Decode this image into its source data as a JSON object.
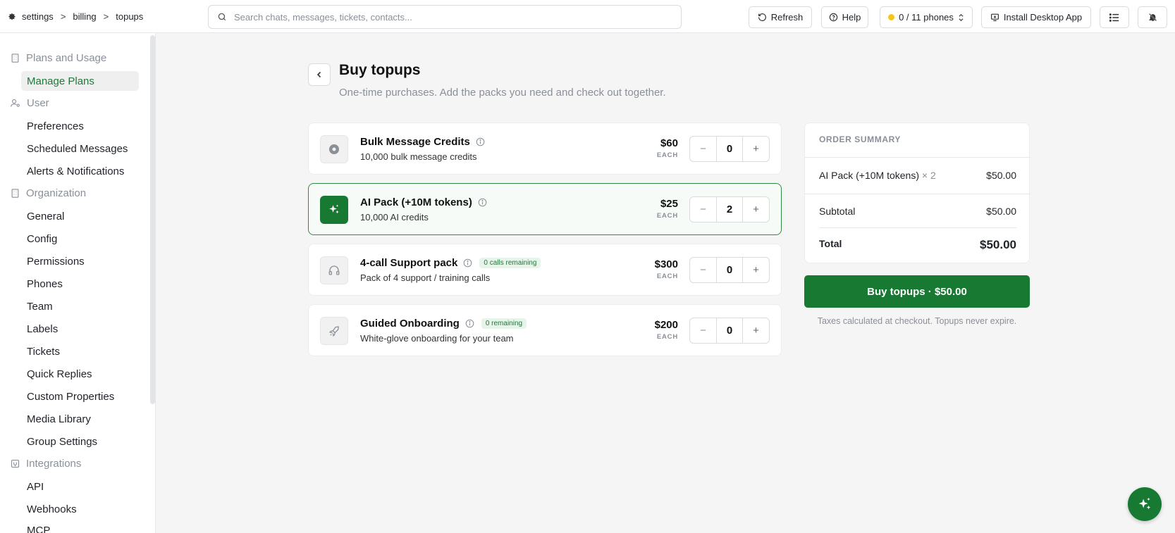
{
  "breadcrumb": {
    "items": [
      "settings",
      "billing",
      "topups"
    ],
    "separator": ">"
  },
  "search": {
    "placeholder": "Search chats, messages, tickets, contacts..."
  },
  "toolbar": {
    "refresh_label": "Refresh",
    "help_label": "Help",
    "phones_label": "0 / 11 phones",
    "install_label": "Install Desktop App"
  },
  "sidebar": {
    "sections": [
      {
        "label": "Plans and Usage",
        "icon": "building-icon"
      },
      {
        "label": "User",
        "icon": "user-gear-icon"
      },
      {
        "label": "Organization",
        "icon": "building-icon"
      },
      {
        "label": "Integrations",
        "icon": "plug-icon"
      }
    ],
    "items": [
      {
        "label": "Manage Plans",
        "active": true
      },
      {
        "label": "Preferences"
      },
      {
        "label": "Scheduled Messages"
      },
      {
        "label": "Alerts & Notifications"
      },
      {
        "label": "General"
      },
      {
        "label": "Config"
      },
      {
        "label": "Permissions"
      },
      {
        "label": "Phones"
      },
      {
        "label": "Team"
      },
      {
        "label": "Labels"
      },
      {
        "label": "Tickets"
      },
      {
        "label": "Quick Replies"
      },
      {
        "label": "Custom Properties"
      },
      {
        "label": "Media Library"
      },
      {
        "label": "Group Settings"
      },
      {
        "label": "API"
      },
      {
        "label": "Webhooks"
      },
      {
        "label": "MCP"
      }
    ]
  },
  "page": {
    "title": "Buy topups",
    "subtitle": "One-time purchases. Add the packs you need and check out together."
  },
  "products": [
    {
      "name": "Bulk Message Credits",
      "desc": "10,000 bulk message credits",
      "price": "$60",
      "unit": "EACH",
      "qty": "0",
      "icon": "circle-dot-icon",
      "badge": ""
    },
    {
      "name": "AI Pack (+10M tokens)",
      "desc": "10,000 AI credits",
      "price": "$25",
      "unit": "EACH",
      "qty": "2",
      "icon": "sparkles-icon",
      "badge": "",
      "selected": true
    },
    {
      "name": "4-call Support pack",
      "desc": "Pack of 4 support / training calls",
      "price": "$300",
      "unit": "EACH",
      "qty": "0",
      "icon": "headphones-icon",
      "badge": "0 calls remaining"
    },
    {
      "name": "Guided Onboarding",
      "desc": "White-glove onboarding for your team",
      "price": "$200",
      "unit": "EACH",
      "qty": "0",
      "icon": "rocket-icon",
      "badge": "0 remaining"
    }
  ],
  "summary": {
    "heading": "ORDER SUMMARY",
    "line_item": {
      "name": "AI Pack (+10M tokens)",
      "qty": "× 2",
      "amount": "$50.00"
    },
    "subtotal_label": "Subtotal",
    "subtotal": "$50.00",
    "total_label": "Total",
    "total": "$50.00"
  },
  "buy_label": "Buy topups · $50.00",
  "note": "Taxes calculated at checkout. Topups never expire.",
  "colors": {
    "accent": "#187a32",
    "muted": "#8a8f98",
    "phone_status": "#f5c518"
  }
}
